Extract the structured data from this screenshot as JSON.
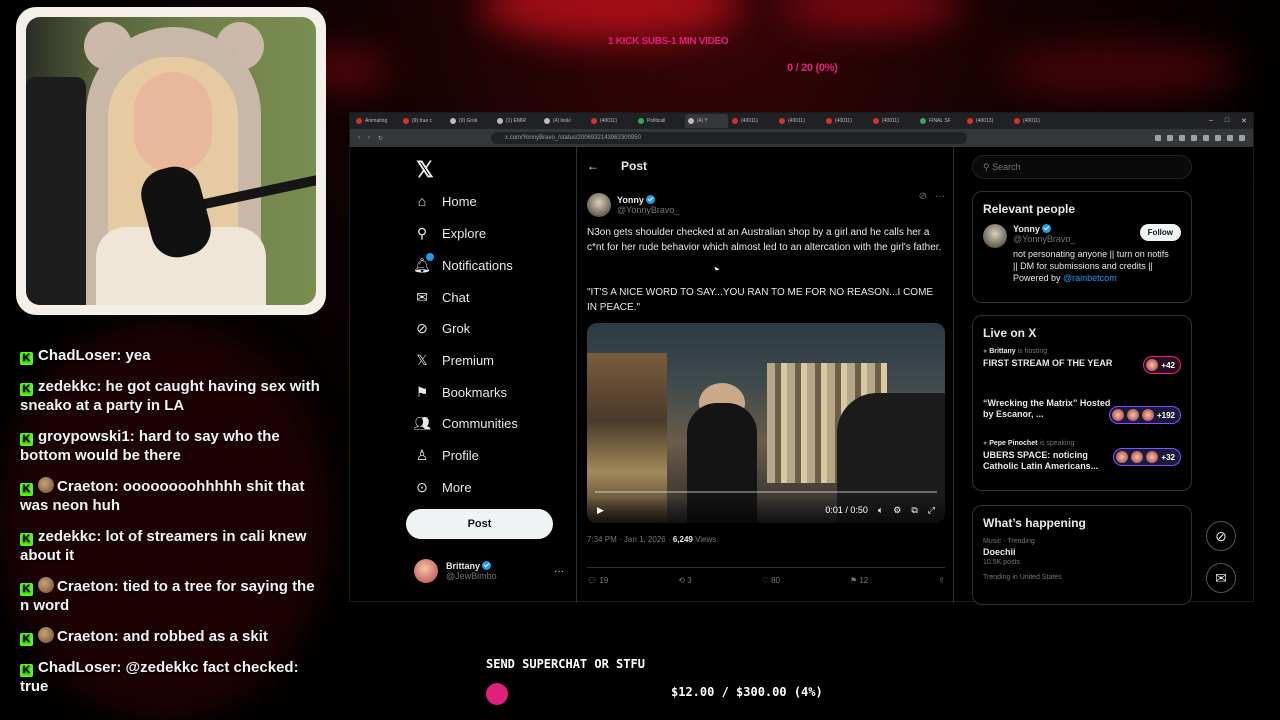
{
  "overlay": {
    "sub_goal_label": "1 KICK SUBS-1 MIN VIDEO",
    "sub_goal_progress": "0 / 20 (0%)",
    "superchat_label": "SEND SUPERCHAT OR STFU",
    "superchat_progress": "$12.00 / $300.00 (4%)",
    "accent": "#e0207a"
  },
  "chat": [
    {
      "user": "ChadLoser",
      "text": "yea",
      "emote": false
    },
    {
      "user": "zedekkc",
      "text": "he got caught having sex with sneako at a party in LA",
      "emote": false
    },
    {
      "user": "groypowski1",
      "text": "hard to say who the bottom would be there",
      "emote": false
    },
    {
      "user": "Craeton",
      "text": "oooooooohhhhh shit that was neon huh",
      "emote": true
    },
    {
      "user": "zedekkc",
      "text": "lot of streamers in cali knew about it",
      "emote": false
    },
    {
      "user": "Craeton",
      "text": "tied to a tree for saying the n word",
      "emote": true
    },
    {
      "user": "Craeton",
      "text": "and robbed as a skit",
      "emote": true
    },
    {
      "user": "ChadLoser",
      "text": "@zedekkc fact checked: true",
      "emote": false
    }
  ],
  "browser": {
    "tabs": [
      "Animating",
      "(9) true c",
      "(9) Grok",
      "(1) EMIR",
      "(4) looki",
      "(40011)",
      "Politicall",
      "(4) Y",
      "(40011)",
      "(40011)",
      "(40011)",
      "(40011)",
      "FINAL SF",
      "(40013)",
      "(40011)"
    ],
    "url": "x.com/YonnyBravo_/status/2006932143963300950"
  },
  "nav": {
    "items": [
      {
        "label": "Home",
        "icon": "home-icon"
      },
      {
        "label": "Explore",
        "icon": "search-icon"
      },
      {
        "label": "Notifications",
        "icon": "bell-icon"
      },
      {
        "label": "Chat",
        "icon": "chat-icon"
      },
      {
        "label": "Grok",
        "icon": "grok-icon"
      },
      {
        "label": "Premium",
        "icon": "x-icon"
      },
      {
        "label": "Bookmarks",
        "icon": "bookmark-icon"
      },
      {
        "label": "Communities",
        "icon": "people-icon"
      },
      {
        "label": "Profile",
        "icon": "person-icon"
      },
      {
        "label": "More",
        "icon": "more-icon"
      }
    ],
    "post_button": "Post",
    "account": {
      "name": "Brittany",
      "handle": "@JewBimbo"
    }
  },
  "post": {
    "header": "Post",
    "author": "Yonny",
    "handle": "@YonnyBravo_",
    "text": "N3on gets shoulder checked at an Australian shop by a girl and he calls her a c*nt for her rude behavior which almost led to an altercation with the girl's father.",
    "quote": "\"IT'S A NICE WORD TO SAY...YOU RAN TO ME FOR NO REASON...I COME IN PEACE.\"",
    "video_time": "0:01 / 0:50",
    "timestamp": "7:34 PM · Jan 1, 2026 · ",
    "views": "6,249",
    "views_label": "Views",
    "replies": "19",
    "reposts": "3",
    "likes": "80",
    "bookmarks": "12"
  },
  "sidebar": {
    "search_placeholder": "Search",
    "relevant_title": "Relevant people",
    "person": {
      "name": "Yonny",
      "handle": "@YonnyBravo_",
      "bio": "not personating anyone || turn on notifs || DM for submissions and credits || Powered by ",
      "bio_link": "@rainbetcom",
      "follow": "Follow"
    },
    "live_title": "Live on X",
    "live": [
      {
        "host": "Brittany",
        "status": "is hosting",
        "title": "FIRST STREAM OF THE YEAR",
        "count": "+42"
      },
      {
        "host": "",
        "status": "",
        "title": "“Wrecking the Matrix” Hosted by Escanor, ...",
        "count": "+192"
      },
      {
        "host": "Pepe Pinochet",
        "status": "is speaking",
        "title": "UBERS SPACE: noticing Catholic Latin Americans...",
        "count": "+32"
      }
    ],
    "happening_title": "What’s happening",
    "trend": {
      "category": "Music · Trending",
      "topic": "Doechii",
      "posts": "10.5K posts",
      "next": "Trending in United States"
    }
  }
}
